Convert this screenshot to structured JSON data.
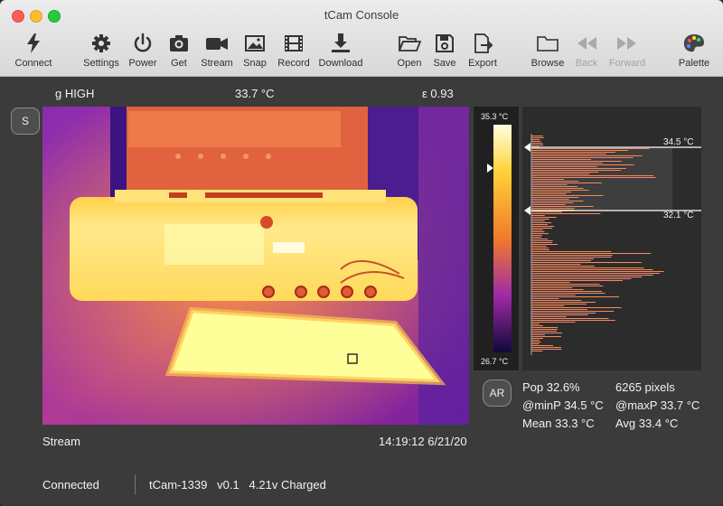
{
  "window": {
    "title": "tCam Console"
  },
  "toolbar": {
    "connect": "Connect",
    "settings": "Settings",
    "power": "Power",
    "get": "Get",
    "stream": "Stream",
    "snap": "Snap",
    "record": "Record",
    "download": "Download",
    "open": "Open",
    "save": "Save",
    "export": "Export",
    "browse": "Browse",
    "back": "Back",
    "forward": "Forward",
    "palette": "Palette"
  },
  "info": {
    "gain": "g HIGH",
    "spot_temp": "33.7 °C",
    "emissivity": "ε 0.93"
  },
  "buttons": {
    "s": "S",
    "ar": "AR"
  },
  "scale": {
    "max": "35.3 °C",
    "min": "26.7 °C"
  },
  "histogram": {
    "upper_marker": "34.5 °C",
    "lower_marker": "32.1 °C"
  },
  "stats": {
    "pop": "Pop 32.6%",
    "pixels": "6265 pixels",
    "minp": "@minP 34.5 °C",
    "maxp": "@maxP 33.7 °C",
    "mean": "Mean 33.3 °C",
    "avg": "Avg 33.4 °C"
  },
  "image_status": {
    "mode": "Stream",
    "timestamp": "14:19:12 6/21/20"
  },
  "status": {
    "connection": "Connected",
    "device": "tCam-1339   v0.1   4.21v Charged"
  },
  "colors": {
    "toolbar_bg": "#e3e3e3",
    "content_bg": "#3b3b3b",
    "hot": "#ffff9a",
    "cold": "#1a0a5a"
  }
}
